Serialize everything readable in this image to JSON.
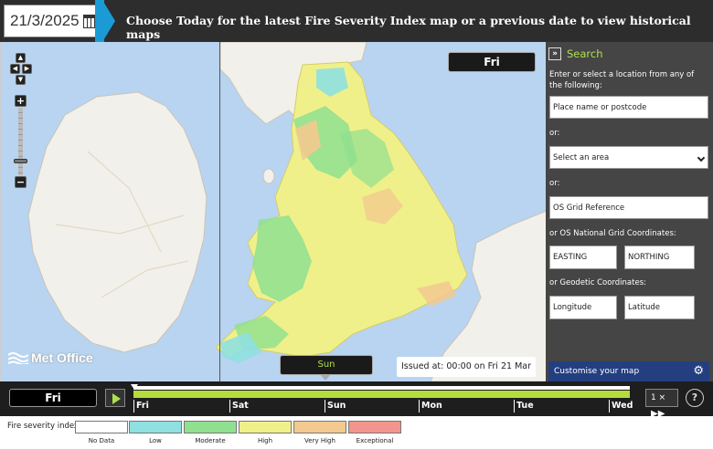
{
  "header": {
    "date_value": "21/3/2025",
    "message": "Choose Today for the latest Fire Severity Index map or a previous date to view historical maps"
  },
  "map": {
    "day_label": "Fri",
    "issued": "Issued at: 00:00 on Fri 21 Mar 2025",
    "logo_text": "Met Office",
    "colors": {
      "sea": "#b8d4f0",
      "land": "#f2f0ea",
      "low": "#8fe0e0",
      "moderate": "#8fe08f",
      "high": "#f0f08a",
      "very_high": "#f2c98f"
    }
  },
  "search": {
    "title": "Search",
    "intro": "Enter or select a location from any of the following:",
    "place_placeholder": "Place name or postcode",
    "or1": "or:",
    "area_select": "Select an area",
    "or2": "or:",
    "os_grid_placeholder": "OS Grid Reference",
    "coords_label": "or OS National Grid Coordinates:",
    "easting_placeholder": "EASTING",
    "northing_placeholder": "NORTHING",
    "geo_label": "or Geodetic Coordinates:",
    "longitude_placeholder": "Longitude",
    "latitude_placeholder": "Latitude",
    "customise_label": "Customise your map"
  },
  "timeline": {
    "current_day": "Fri",
    "popup_day": "Sun",
    "days": [
      "Fri",
      "Sat",
      "Sun",
      "Mon",
      "Tue",
      "Wed"
    ],
    "speed_label": "1 ×",
    "help_label": "?"
  },
  "legend": {
    "title": "Fire severity index:",
    "items": [
      {
        "label": "No Data",
        "color": "#ffffff"
      },
      {
        "label": "Low",
        "color": "#8fe0e0"
      },
      {
        "label": "Moderate",
        "color": "#8fe08f"
      },
      {
        "label": "High",
        "color": "#f0f08a"
      },
      {
        "label": "Very High",
        "color": "#f2c98f"
      },
      {
        "label": "Exceptional",
        "color": "#f2958c"
      }
    ]
  }
}
